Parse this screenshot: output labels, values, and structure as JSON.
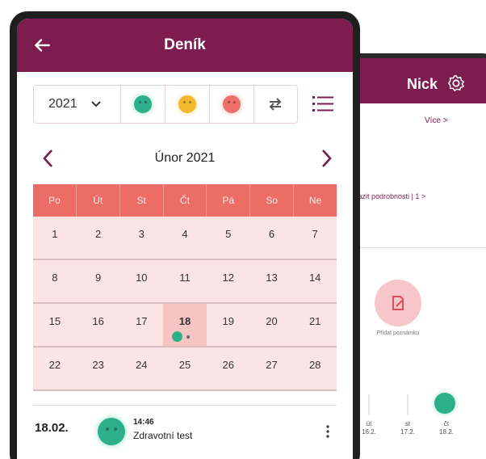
{
  "back_screen": {
    "title": "Nick",
    "more_link": "Více  >",
    "details_link": "zobrazit podrobnosti | 1  >",
    "add_note_label": "Přidat poznámku",
    "days": [
      {
        "name": "út",
        "date": "16.2."
      },
      {
        "name": "st",
        "date": "17.2."
      },
      {
        "name": "čt",
        "date": "18.2."
      }
    ]
  },
  "header": {
    "title": "Deník"
  },
  "toolbar": {
    "year": "2021"
  },
  "calendar": {
    "month_label": "Únor 2021",
    "weekdays": [
      "Po",
      "Út",
      "St",
      "Čt",
      "Pá",
      "So",
      "Ne"
    ],
    "weeks": [
      [
        "1",
        "2",
        "3",
        "4",
        "5",
        "6",
        "7"
      ],
      [
        "8",
        "9",
        "10",
        "11",
        "12",
        "13",
        "14"
      ],
      [
        "15",
        "16",
        "17",
        "18",
        "19",
        "20",
        "21"
      ],
      [
        "22",
        "23",
        "24",
        "25",
        "26",
        "27",
        "28"
      ]
    ],
    "selected_day": "18"
  },
  "entry": {
    "date": "18.02.",
    "time": "14:46",
    "title": "Zdravotní test"
  },
  "colors": {
    "brand": "#7c1c4f",
    "calendar_header": "#ec6d66",
    "calendar_body": "#fde4e4",
    "mood_good": "#2db089",
    "mood_neutral": "#f4b82e",
    "mood_bad": "#ef6f6b"
  }
}
